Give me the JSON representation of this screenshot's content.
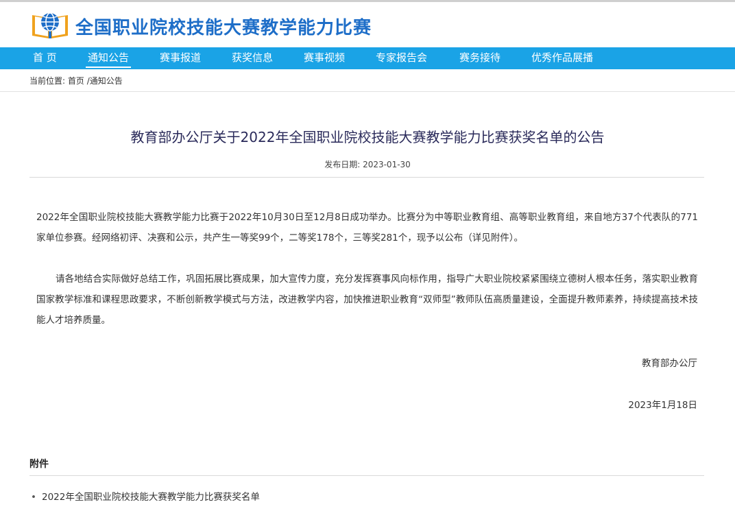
{
  "header": {
    "site_title": "全国职业院校技能大赛教学能力比赛",
    "logo_icon": "book-globe-logo",
    "brand_color": "#1e6ec8"
  },
  "nav": {
    "bar_color": "#1aa3e6",
    "items": [
      {
        "label": "首 页"
      },
      {
        "label": "通知公告",
        "active": true
      },
      {
        "label": "赛事报道"
      },
      {
        "label": "获奖信息"
      },
      {
        "label": "赛事视频"
      },
      {
        "label": "专家报告会"
      },
      {
        "label": "赛务接待"
      },
      {
        "label": "优秀作品展播"
      }
    ]
  },
  "breadcrumb": {
    "prefix": "当前位置:",
    "home": "首页",
    "separator": "/",
    "current": "通知公告"
  },
  "article": {
    "title": "教育部办公厅关于2022年全国职业院校技能大赛教学能力比赛获奖名单的公告",
    "date_label": "发布日期:",
    "date": "2023-01-30",
    "paragraphs": [
      "2022年全国职业院校技能大赛教学能力比赛于2022年10月30日至12月8日成功举办。比赛分为中等职业教育组、高等职业教育组，来自地方37个代表队的771家单位参赛。经网络初评、决赛和公示，共产生一等奖99个，二等奖178个，三等奖281个，现予以公布（详见附件）。",
      "请各地结合实际做好总结工作，巩固拓展比赛成果，加大宣传力度，充分发挥赛事风向标作用，指导广大职业院校紧紧围绕立德树人根本任务，落实职业教育国家教学标准和课程思政要求，不断创新教学模式与方法，改进教学内容，加快推进职业教育“双师型”教师队伍高质量建设，全面提升教师素养，持续提高技术技能人才培养质量。"
    ],
    "signature_org": "教育部办公厅",
    "signature_date": "2023年1月18日"
  },
  "attachments": {
    "heading": "附件",
    "items": [
      {
        "bullet": "•",
        "label": "2022年全国职业院校技能大赛教学能力比赛获奖名单"
      }
    ]
  }
}
